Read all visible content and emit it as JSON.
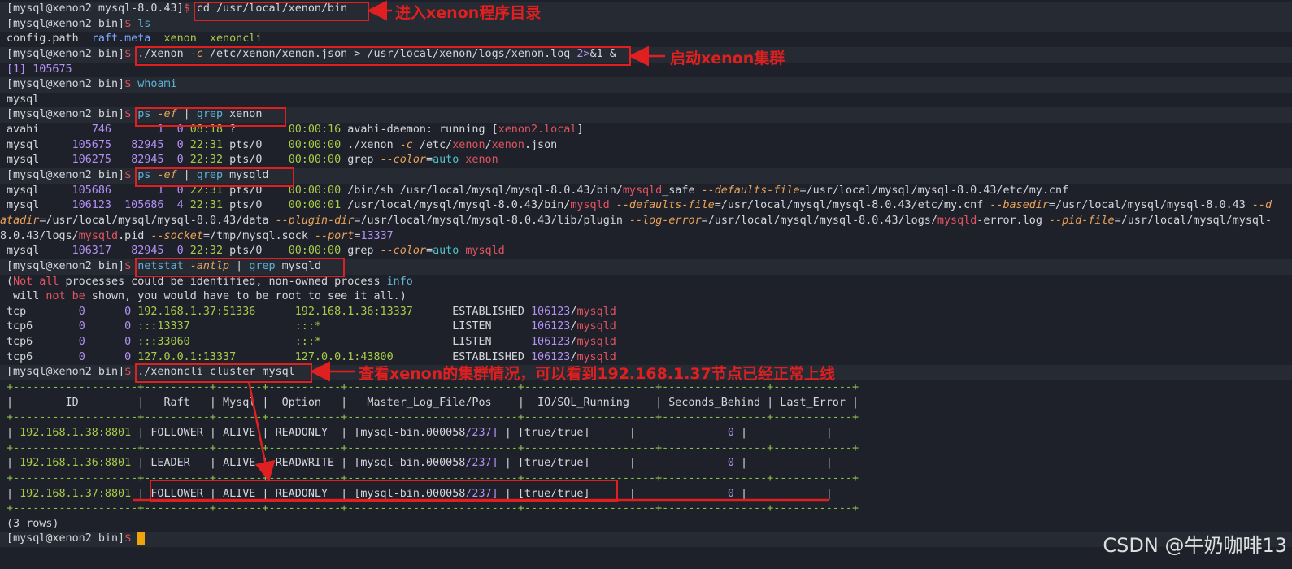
{
  "prompts": {
    "p1": "[mysql@xenon2 mysql-8.0.43]",
    "p2": "[mysql@xenon2 bin]",
    "dollar": "$"
  },
  "cmds": {
    "cd": "cd /usr/local/xenon/bin",
    "ls": "ls",
    "start_pre": "./xenon ",
    "start_flag": "-c",
    "start_mid": " /etc/xenon/xenon.json > /usr/local/xenon/logs/xenon.log ",
    "start_redir": "2>",
    "start_end": "&1 &",
    "whoami": "whoami",
    "ps1_a": "ps ",
    "ps_flag": "-ef",
    "pipe": " | ",
    "grep": "grep",
    "ps1_b": " xenon",
    "ps2_b": " mysqld",
    "netstat": "netstat",
    "netstat_flag": "-antlp",
    "cluster": "./xenoncli cluster mysql"
  },
  "outputs": {
    "ls_config": "config.path",
    "ls_raft": "raft.meta",
    "ls_xenon": "xenon",
    "ls_xenoncli": "xenoncli",
    "job": "[1] 105675",
    "whoami_out": "mysql"
  },
  "ps_xenon": {
    "r1_user": "avahi",
    "r1_pid": "746",
    "r1_ppid": "1",
    "r1_c": "0",
    "r1_time": "08:18",
    "r1_tty": "?",
    "r1_cpu": "00:00:16",
    "r1_cmd_a": "avahi-daemon: running ",
    "r1_cmd_b": "[",
    "r1_cmd_c": "xenon2.local",
    "r1_cmd_d": "]",
    "r2_user": "mysql",
    "r2_pid": "105675",
    "r2_ppid": "82945",
    "r2_c": "0",
    "r2_time": "22:31",
    "r2_tty": "pts/0",
    "r2_cpu": "00:00:00",
    "r2_cmd_a": "./xenon ",
    "r2_cmd_flag": "-c",
    "r2_cmd_b": " /etc/",
    "r2_cmd_x1": "xenon",
    "r2_cmd_c": "/",
    "r2_cmd_x2": "xenon",
    "r2_cmd_d": ".json",
    "r3_user": "mysql",
    "r3_pid": "106275",
    "r3_ppid": "82945",
    "r3_c": "0",
    "r3_time": "22:32",
    "r3_tty": "pts/0",
    "r3_cpu": "00:00:00",
    "r3_cmd_a": "grep ",
    "r3_cmd_flag": "--color",
    "r3_cmd_b": "=",
    "r3_cmd_c": "auto",
    "r3_cmd_d": " xenon"
  },
  "ps_mysqld": {
    "r1_user": "mysql",
    "r1_pid": "105686",
    "r1_ppid": "1",
    "r1_c": "0",
    "r1_time": "22:31",
    "r1_tty": "pts/0",
    "r1_cpu": "00:00:00",
    "r1_cmd_a": "/bin/sh /usr/local/mysql/mysql-8.0.43/bin/",
    "r1_cmd_b": "mysqld",
    "r1_cmd_c": "_safe ",
    "r1_cmd_flag": "--defaults-file",
    "r1_cmd_d": "=/usr/local/mysql/mysql-8.0.43/etc/my.cnf",
    "r2_user": "mysql",
    "r2_pid": "106123",
    "r2_ppid": "105686",
    "r2_c": "4",
    "r2_time": "22:31",
    "r2_tty": "pts/0",
    "r2_cpu": "00:00:01",
    "r2_cmd_a": "/usr/local/mysql/mysql-8.0.43/bin/",
    "r2_cmd_b": "mysqld",
    "r2_cmd_c": " ",
    "r2_cmd_f1": "--defaults-file",
    "r2_cmd_d": "=/usr/local/mysql/mysql-8.0.43/etc/my.cnf ",
    "r2_cmd_f2": "--basedir",
    "r2_cmd_e": "=/usr/local/mysql/mysql-8.0.43 ",
    "r2_cmd_f3": "--d",
    "w1_a": "atadir",
    "w1_b": "=/usr/local/mysql/mysql-8.0.43/data ",
    "w1_f1": "--plugin-dir",
    "w1_c": "=/usr/local/mysql/mysql-8.0.43/lib/plugin ",
    "w1_f2": "--log-error",
    "w1_d": "=/usr/local/mysql/mysql-8.0.43/logs/",
    "w1_e": "mysqld",
    "w1_f": "-error.log ",
    "w1_f3": "--pid-file",
    "w1_g": "=/usr/local/mysql/mysql-",
    "w2_a": "8.0.43/logs/",
    "w2_b": "mysqld",
    "w2_c": ".pid ",
    "w2_f1": "--socket",
    "w2_d": "=/tmp/mysql.sock ",
    "w2_f2": "--port",
    "w2_e": "=",
    "w2_port": "13337",
    "r3_user": "mysql",
    "r3_pid": "106317",
    "r3_ppid": "82945",
    "r3_c": "0",
    "r3_time": "22:32",
    "r3_tty": "pts/0",
    "r3_cpu": "00:00:00",
    "r3_cmd_a": "grep ",
    "r3_cmd_flag": "--color",
    "r3_cmd_b": "=",
    "r3_cmd_c": "auto",
    "r3_cmd_d": " mysqld"
  },
  "netstat_out": {
    "warn1_a": "(",
    "warn1_not": "Not all",
    "warn1_b": " processes could be identified, non-owned process ",
    "warn1_info": "info",
    "warn2_a": " will ",
    "warn2_not": "not be",
    "warn2_b": " shown, you would have to be root to see it all.)",
    "rows": [
      {
        "proto": "tcp",
        "recv": "0",
        "send": "0",
        "local": "192.168.1.37:51336",
        "foreign": "192.168.1.36:13337",
        "state": "ESTABLISHED",
        "pid": "106123",
        "prog": "mysqld"
      },
      {
        "proto": "tcp6",
        "recv": "0",
        "send": "0",
        "local": ":::13337",
        "foreign": ":::*",
        "state": "LISTEN",
        "pid": "106123",
        "prog": "mysqld"
      },
      {
        "proto": "tcp6",
        "recv": "0",
        "send": "0",
        "local": ":::33060",
        "foreign": ":::*",
        "state": "LISTEN",
        "pid": "106123",
        "prog": "mysqld"
      },
      {
        "proto": "tcp6",
        "recv": "0",
        "send": "0",
        "local": "127.0.0.1:13337",
        "foreign": "127.0.0.1:43800",
        "state": "ESTABLISHED",
        "pid": "106123",
        "prog": "mysqld"
      }
    ]
  },
  "cluster_table": {
    "border": "+-------------------+----------+-------+-----------+--------------------------+--------------------+----------------+------------+",
    "header": "|        ID         |   Raft   | Mysql |  Option   |   Master_Log_File/Pos    |  IO/SQL_Running    | Seconds_Behind | Last_Error |",
    "rows": [
      {
        "id": "192.168.1.38:8801",
        "raft": "FOLLOWER",
        "mysql": "ALIVE",
        "option": "READONLY ",
        "log_a": "[mysql-bin.000058",
        "log_b": "/237]",
        "io": "[true/true]   ",
        "sb": "0"
      },
      {
        "id": "192.168.1.36:8801",
        "raft": "LEADER  ",
        "mysql": "ALIVE",
        "option": "READWRITE",
        "log_a": "[mysql-bin.000058",
        "log_b": "/237]",
        "io": "[true/true]   ",
        "sb": "0"
      },
      {
        "id": "192.168.1.37:8801",
        "raft": "FOLLOWER",
        "mysql": "ALIVE",
        "option": "READONLY ",
        "log_a": "[mysql-bin.000058",
        "log_b": "/237]",
        "io": "[true/true]   ",
        "sb": "0"
      }
    ],
    "rows_count": "(3 rows)"
  },
  "annotations": {
    "a1": "进入xenon程序目录",
    "a2": "启动xenon集群",
    "a3": "查看xenon的集群情况，可以看到192.168.1.37节点已经正常上线"
  },
  "watermark": "CSDN @牛奶咖啡13",
  "colors": {
    "background": "#1e2129",
    "prompt_dollar": "#e05561",
    "flag": "#e8a25a",
    "number": "#b391f5",
    "table_border": "#8bc34a",
    "annotation": "#e02020",
    "cursor": "#f0a30a"
  }
}
